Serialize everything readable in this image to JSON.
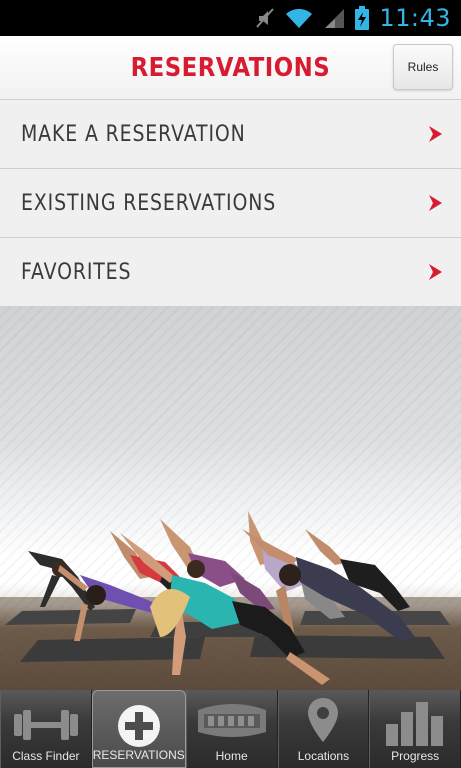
{
  "status_bar": {
    "time": "11:43",
    "icons": [
      "mute-icon",
      "wifi-icon",
      "signal-icon",
      "battery-charging-icon"
    ]
  },
  "header": {
    "title": "RESERVATIONS",
    "rules_label": "Rules"
  },
  "menu": {
    "items": [
      {
        "label": "MAKE A RESERVATION",
        "icon": "chevron-right-icon"
      },
      {
        "label": "EXISTING RESERVATIONS",
        "icon": "chevron-right-icon"
      },
      {
        "label": "FAVORITES",
        "icon": "chevron-right-icon"
      }
    ]
  },
  "colors": {
    "accent": "#d71c32",
    "status_blue": "#33b5e5",
    "menu_bg": "#f0f0f0",
    "nav_bg": "#3a3a3a"
  },
  "bottom_nav": {
    "items": [
      {
        "label": "Class Finder",
        "icon": "dumbbell-icon"
      },
      {
        "label": "RESERVATIONS",
        "icon": "plus-circle-icon",
        "active": true
      },
      {
        "label": "Home",
        "icon": "crunch-logo-icon"
      },
      {
        "label": "Locations",
        "icon": "map-pin-icon"
      },
      {
        "label": "Progress",
        "icon": "bar-chart-icon"
      }
    ]
  }
}
